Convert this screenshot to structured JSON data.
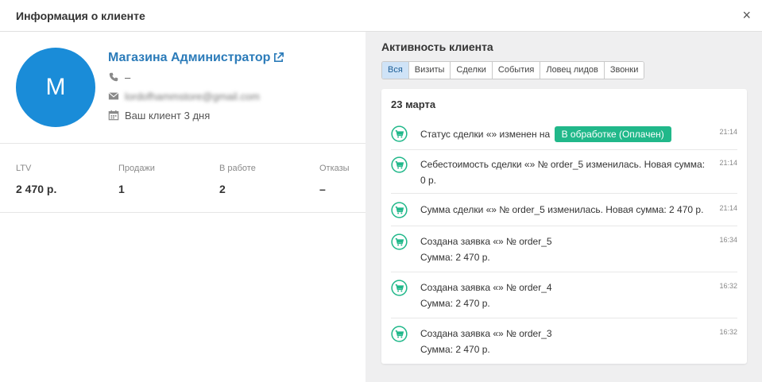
{
  "header": {
    "title": "Информация о клиенте",
    "close": "×"
  },
  "client": {
    "avatar_letter": "M",
    "avatar_color": "#1a8cd8",
    "name": "Магазина Администратор",
    "phone": "–",
    "email": "lordofhammstore@gmail.com",
    "since": "Ваш клиент 3 дня"
  },
  "stats": [
    {
      "label": "LTV",
      "value": "2 470 р."
    },
    {
      "label": "Продажи",
      "value": "1"
    },
    {
      "label": "В работе",
      "value": "2"
    },
    {
      "label": "Отказы",
      "value": "–"
    }
  ],
  "activity": {
    "title": "Активность клиента",
    "tabs": [
      "Вся",
      "Визиты",
      "Сделки",
      "События",
      "Ловец лидов",
      "Звонки"
    ],
    "active_tab": "Вся",
    "date": "23 марта",
    "events": [
      {
        "line1": "Статус сделки «» изменен на",
        "badge": "В обработке (Оплачен)",
        "line2": "",
        "time": "21:14"
      },
      {
        "line1": "Себестоимость сделки «» № order_5 изменилась. Новая сумма: 0 р.",
        "line2": "",
        "time": "21:14"
      },
      {
        "line1": "Сумма сделки «» № order_5 изменилась. Новая сумма: 2 470 р.",
        "line2": "",
        "time": "21:14"
      },
      {
        "line1": "Создана заявка «» № order_5",
        "line2": "Сумма: 2 470 р.",
        "time": "16:34"
      },
      {
        "line1": "Создана заявка «» № order_4",
        "line2": "Сумма: 2 470 р.",
        "time": "16:32"
      },
      {
        "line1": "Создана заявка «» № order_3",
        "line2": "Сумма: 2 470 р.",
        "time": "16:32"
      }
    ],
    "icon_color": "#21b88a",
    "badge_color": "#21b88a"
  }
}
